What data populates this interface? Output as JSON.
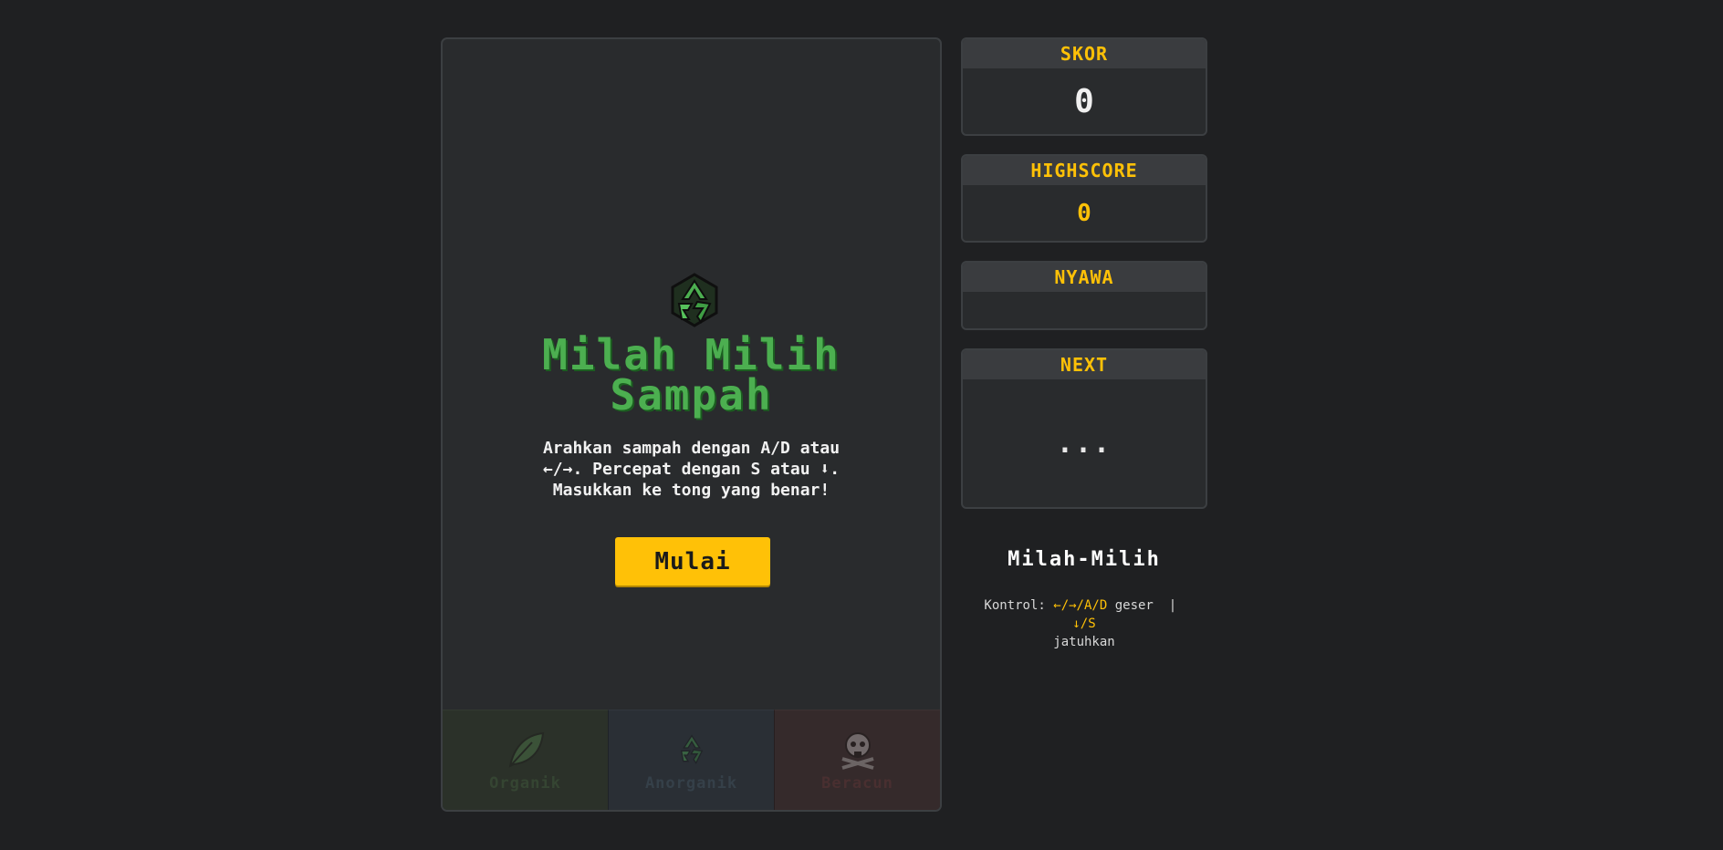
{
  "game": {
    "title_line1": "Milah Milih",
    "title_line2": "Sampah",
    "instructions_line1": "Arahkan sampah dengan A/D atau",
    "instructions_line2": "←/→. Percepat dengan S atau ⬇.",
    "instructions_line3": "Masukkan ke tong yang benar!",
    "start_label": "Mulai",
    "logo_icon": "recycle-icon",
    "accent_green": "#4caf50",
    "accent_yellow": "#ffc107"
  },
  "bins": [
    {
      "label": "Organik",
      "icon": "leaf-icon"
    },
    {
      "label": "Anorganik",
      "icon": "recycle-icon"
    },
    {
      "label": "Beracun",
      "icon": "skull-icon"
    }
  ],
  "sidebar": {
    "score": {
      "label": "SKOR",
      "value": "0"
    },
    "highscore": {
      "label": "HIGHSCORE",
      "value": "0"
    },
    "lives": {
      "label": "NYAWA",
      "value": ""
    },
    "next": {
      "label": "NEXT",
      "value": "..."
    },
    "app_name": "Milah-Milih",
    "controls": {
      "prefix": "Kontrol:",
      "move_keys": "←/→/A/D",
      "move_text": "geser",
      "separator": "|",
      "drop_keys": "↓/S",
      "drop_text": "jatuhkan"
    }
  }
}
